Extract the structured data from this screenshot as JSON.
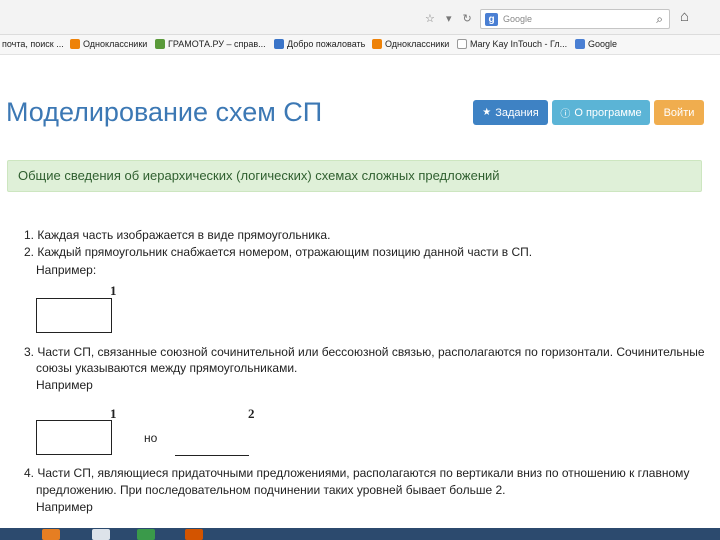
{
  "browser": {
    "search_engine": "Google",
    "bookmarks": [
      "почта, поиск ...",
      "Одноклассники",
      "ГРАМОТА.РУ – справ...",
      "Добро пожаловать",
      "Одноклассники",
      "Mary Kay InTouch - Гл...",
      "Google"
    ]
  },
  "header": {
    "title": "Моделирование схем СП",
    "buttons": {
      "tasks": "Задания",
      "about": "О программе",
      "login": "Войти"
    }
  },
  "alert": "Общие сведения об иерархических (логических) схемах сложных предложений",
  "content": {
    "line1": "1. Каждая часть изображается в виде прямоугольника.",
    "line2": "2. Каждый прямоугольник снабжается номером, отражающим позицию данной части в СП.",
    "example1": "Например:",
    "box1_num": "1",
    "line3a": "3. Части СП, связанные союзной сочинительной или бессоюзной связью, располагаются по горизонтали. Сочинительные",
    "line3b": "союзы указываются между прямоугольниками.",
    "example2": "Например",
    "box2_num1": "1",
    "box2_num2": "2",
    "conj": "но",
    "line4a": "4. Части СП, являющиеся придаточными предложениями, располагаются по вертикали вниз по отношению к главному",
    "line4b": "предложению. При последовательном подчинении таких уровней бывает больше 2.",
    "example3": "Например"
  },
  "colors": {
    "title": "#3c78b4",
    "btn_tasks": "#3e82c4",
    "btn_about": "#5bb4d6",
    "btn_login": "#f0ad4e",
    "alert_bg": "#dff0d8"
  }
}
